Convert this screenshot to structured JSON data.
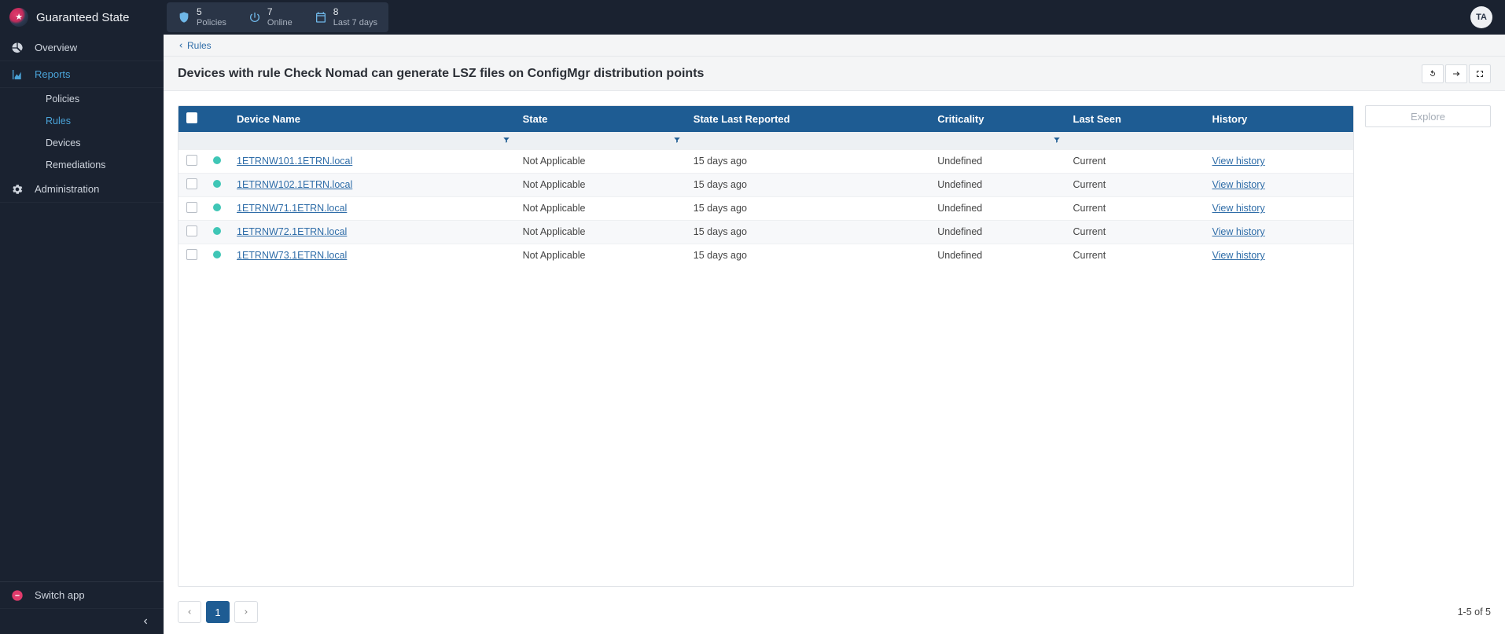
{
  "app": {
    "title": "Guaranteed State",
    "userInitials": "TA"
  },
  "stats": {
    "policies": {
      "value": "5",
      "label": "Policies"
    },
    "online": {
      "value": "7",
      "label": "Online"
    },
    "period": {
      "value": "8",
      "label": "Last 7 days"
    }
  },
  "sidebar": {
    "overview": "Overview",
    "reports": "Reports",
    "sub": {
      "policies": "Policies",
      "rules": "Rules",
      "devices": "Devices",
      "remediations": "Remediations"
    },
    "administration": "Administration",
    "switchApp": "Switch app"
  },
  "breadcrumb": {
    "back": "Rules"
  },
  "page": {
    "title": "Devices with rule Check Nomad can generate LSZ files on ConfigMgr distribution points"
  },
  "explore": {
    "label": "Explore"
  },
  "columns": {
    "deviceName": "Device Name",
    "state": "State",
    "stateLastReported": "State Last Reported",
    "criticality": "Criticality",
    "lastSeen": "Last Seen",
    "history": "History"
  },
  "historyLink": "View history",
  "rows": [
    {
      "device": "1ETRNW101.1ETRN.local",
      "state": "Not Applicable",
      "reported": "15 days ago",
      "criticality": "Undefined",
      "lastSeen": "Current"
    },
    {
      "device": "1ETRNW102.1ETRN.local",
      "state": "Not Applicable",
      "reported": "15 days ago",
      "criticality": "Undefined",
      "lastSeen": "Current"
    },
    {
      "device": "1ETRNW71.1ETRN.local",
      "state": "Not Applicable",
      "reported": "15 days ago",
      "criticality": "Undefined",
      "lastSeen": "Current"
    },
    {
      "device": "1ETRNW72.1ETRN.local",
      "state": "Not Applicable",
      "reported": "15 days ago",
      "criticality": "Undefined",
      "lastSeen": "Current"
    },
    {
      "device": "1ETRNW73.1ETRN.local",
      "state": "Not Applicable",
      "reported": "15 days ago",
      "criticality": "Undefined",
      "lastSeen": "Current"
    }
  ],
  "pager": {
    "current": "1",
    "info": "1-5 of 5"
  }
}
